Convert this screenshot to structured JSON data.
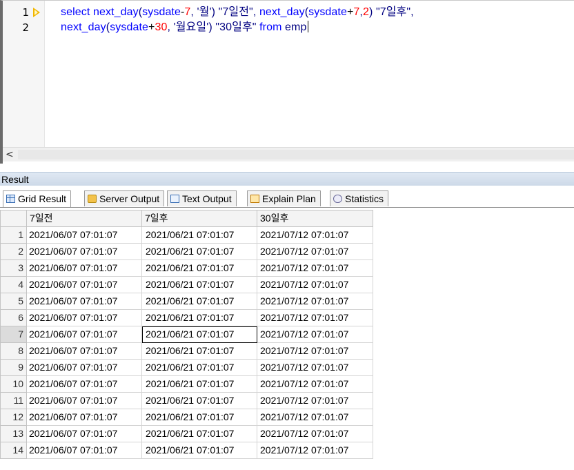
{
  "editor": {
    "lines": [
      {
        "number": "1"
      },
      {
        "number": "2"
      }
    ],
    "line1": {
      "t1": "select ",
      "t2": "next_day",
      "t3": "(",
      "t4": "sysdate",
      "t5": "-",
      "t6": "7",
      "t7": ", ",
      "t8": "'월'",
      "t9": ") ",
      "t10": "\"7일전\"",
      "t11": ", ",
      "t12": "next_day",
      "t13": "(",
      "t14": "sysdate",
      "t15": "+",
      "t16": "7",
      "t17": ",",
      "t18": "2",
      "t19": ") ",
      "t20": "\"7일후\"",
      "t21": ","
    },
    "line2": {
      "t1": "next_day",
      "t2": "(",
      "t3": "sysdate",
      "t4": "+",
      "t5": "30",
      "t6": ", ",
      "t7": "'월요일'",
      "t8": ") ",
      "t9": "\"30일후\"",
      "t10": " from ",
      "t11": "emp"
    },
    "scroll_left": "<"
  },
  "result": {
    "title": "Result",
    "tabs": [
      {
        "label": "Grid Result"
      },
      {
        "label": "Server Output"
      },
      {
        "label": "Text Output"
      },
      {
        "label": "Explain Plan"
      },
      {
        "label": "Statistics"
      }
    ],
    "columns": [
      "7일전",
      "7일후",
      "30일후"
    ],
    "rows": [
      {
        "n": "1",
        "a": "2021/06/07 07:01:07",
        "b": "2021/06/21 07:01:07",
        "c": "2021/07/12 07:01:07"
      },
      {
        "n": "2",
        "a": "2021/06/07 07:01:07",
        "b": "2021/06/21 07:01:07",
        "c": "2021/07/12 07:01:07"
      },
      {
        "n": "3",
        "a": "2021/06/07 07:01:07",
        "b": "2021/06/21 07:01:07",
        "c": "2021/07/12 07:01:07"
      },
      {
        "n": "4",
        "a": "2021/06/07 07:01:07",
        "b": "2021/06/21 07:01:07",
        "c": "2021/07/12 07:01:07"
      },
      {
        "n": "5",
        "a": "2021/06/07 07:01:07",
        "b": "2021/06/21 07:01:07",
        "c": "2021/07/12 07:01:07"
      },
      {
        "n": "6",
        "a": "2021/06/07 07:01:07",
        "b": "2021/06/21 07:01:07",
        "c": "2021/07/12 07:01:07"
      },
      {
        "n": "7",
        "a": "2021/06/07 07:01:07",
        "b": "2021/06/21 07:01:07",
        "c": "2021/07/12 07:01:07"
      },
      {
        "n": "8",
        "a": "2021/06/07 07:01:07",
        "b": "2021/06/21 07:01:07",
        "c": "2021/07/12 07:01:07"
      },
      {
        "n": "9",
        "a": "2021/06/07 07:01:07",
        "b": "2021/06/21 07:01:07",
        "c": "2021/07/12 07:01:07"
      },
      {
        "n": "10",
        "a": "2021/06/07 07:01:07",
        "b": "2021/06/21 07:01:07",
        "c": "2021/07/12 07:01:07"
      },
      {
        "n": "11",
        "a": "2021/06/07 07:01:07",
        "b": "2021/06/21 07:01:07",
        "c": "2021/07/12 07:01:07"
      },
      {
        "n": "12",
        "a": "2021/06/07 07:01:07",
        "b": "2021/06/21 07:01:07",
        "c": "2021/07/12 07:01:07"
      },
      {
        "n": "13",
        "a": "2021/06/07 07:01:07",
        "b": "2021/06/21 07:01:07",
        "c": "2021/07/12 07:01:07"
      },
      {
        "n": "14",
        "a": "2021/06/07 07:01:07",
        "b": "2021/06/21 07:01:07",
        "c": "2021/07/12 07:01:07"
      }
    ]
  },
  "colors": {
    "keyword": "#0000ff",
    "function": "#000080",
    "number": "#ff0000",
    "current_line_marker": "#f2b600"
  },
  "icons": {
    "current_line": "yellow-arrow-icon",
    "grid_tab": "grid-icon",
    "server_tab": "server-output-icon",
    "text_tab": "text-output-icon",
    "plan_tab": "explain-plan-icon",
    "stats_tab": "statistics-icon"
  }
}
